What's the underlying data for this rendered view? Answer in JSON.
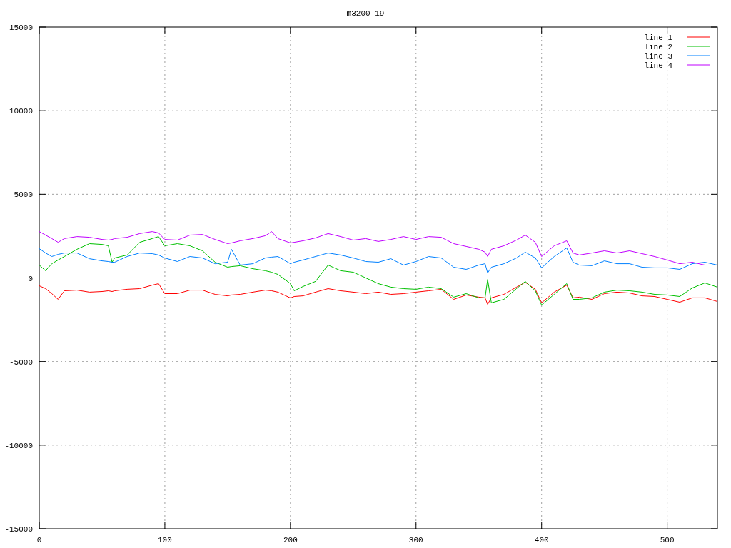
{
  "chart": {
    "chart_data": {
      "type": "line",
      "title": "m3200_19",
      "x": [
        0,
        5,
        10,
        15,
        20,
        30,
        40,
        50,
        55,
        58,
        60,
        70,
        80,
        90,
        95,
        100,
        110,
        120,
        130,
        140,
        150,
        153,
        160,
        170,
        180,
        185,
        190,
        200,
        203,
        210,
        220,
        230,
        240,
        250,
        260,
        270,
        280,
        290,
        300,
        310,
        320,
        330,
        340,
        350,
        355,
        357,
        360,
        370,
        380,
        387,
        395,
        400,
        410,
        420,
        425,
        430,
        440,
        450,
        460,
        470,
        480,
        490,
        500,
        510,
        520,
        530,
        540
      ],
      "series": [
        {
          "name": "line 1",
          "color": "#ff0000",
          "values": [
            -470,
            -640,
            -940,
            -1280,
            -770,
            -730,
            -850,
            -810,
            -770,
            -810,
            -770,
            -680,
            -640,
            -430,
            -340,
            -940,
            -940,
            -730,
            -730,
            -980,
            -1070,
            -1020,
            -980,
            -850,
            -730,
            -770,
            -850,
            -1200,
            -1110,
            -1070,
            -850,
            -640,
            -770,
            -850,
            -940,
            -850,
            -980,
            -940,
            -850,
            -770,
            -680,
            -1280,
            -1020,
            -1150,
            -1190,
            -1580,
            -1190,
            -980,
            -550,
            -260,
            -680,
            -1490,
            -850,
            -430,
            -1190,
            -1150,
            -1280,
            -940,
            -850,
            -900,
            -1070,
            -1110,
            -1280,
            -1450,
            -1190,
            -1190,
            -1410
          ]
        },
        {
          "name": "line 2",
          "color": "#00c000",
          "values": [
            770,
            430,
            850,
            1070,
            1280,
            1710,
            2050,
            2000,
            1920,
            940,
            1190,
            1370,
            2130,
            2350,
            2470,
            1920,
            2050,
            1920,
            1620,
            940,
            640,
            680,
            730,
            550,
            430,
            340,
            210,
            -340,
            -770,
            -510,
            -210,
            770,
            430,
            340,
            0,
            -340,
            -550,
            -640,
            -680,
            -550,
            -640,
            -1150,
            -940,
            -1190,
            -1190,
            -90,
            -1490,
            -1280,
            -640,
            -210,
            -770,
            -1620,
            -980,
            -340,
            -1280,
            -1280,
            -1190,
            -850,
            -730,
            -770,
            -850,
            -980,
            -1020,
            -1110,
            -600,
            -300,
            -550
          ]
        },
        {
          "name": "line 3",
          "color": "#0080ff",
          "values": [
            1750,
            1490,
            1280,
            1410,
            1490,
            1490,
            1150,
            1020,
            980,
            940,
            940,
            1280,
            1490,
            1450,
            1370,
            1190,
            980,
            1280,
            1190,
            850,
            940,
            1710,
            770,
            850,
            1190,
            1240,
            1280,
            850,
            940,
            1070,
            1280,
            1490,
            1370,
            1190,
            980,
            940,
            1150,
            770,
            980,
            1280,
            1190,
            640,
            510,
            770,
            850,
            300,
            640,
            850,
            1190,
            1540,
            1190,
            600,
            1280,
            1790,
            940,
            770,
            730,
            1020,
            850,
            850,
            640,
            600,
            600,
            510,
            850,
            940,
            770
          ]
        },
        {
          "name": "line 4",
          "color": "#c000ff",
          "values": [
            2770,
            2560,
            2350,
            2130,
            2350,
            2470,
            2430,
            2300,
            2260,
            2300,
            2350,
            2430,
            2650,
            2770,
            2690,
            2300,
            2260,
            2560,
            2600,
            2300,
            2050,
            2090,
            2220,
            2350,
            2520,
            2770,
            2350,
            2090,
            2130,
            2220,
            2390,
            2650,
            2470,
            2260,
            2350,
            2180,
            2300,
            2470,
            2300,
            2470,
            2430,
            2050,
            1880,
            1710,
            1540,
            1280,
            1710,
            1920,
            2260,
            2560,
            2130,
            1280,
            1920,
            2220,
            1490,
            1370,
            1490,
            1620,
            1490,
            1620,
            1450,
            1280,
            1070,
            850,
            940,
            770,
            770
          ]
        }
      ],
      "xlim": [
        0,
        540
      ],
      "ylim": [
        -15000,
        15000
      ],
      "xticks": [
        0,
        100,
        200,
        300,
        400,
        500
      ],
      "yticks": [
        -15000,
        -10000,
        -5000,
        0,
        5000,
        10000,
        15000
      ],
      "grid": true,
      "legend": true
    }
  }
}
